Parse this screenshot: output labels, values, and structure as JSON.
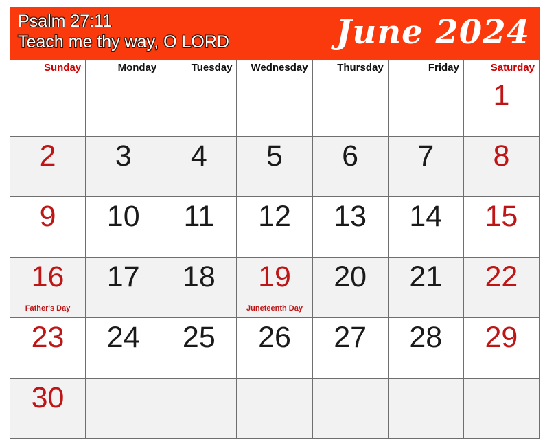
{
  "banner": {
    "verse_reference": "Psalm 27:11",
    "verse_text": "Teach me thy way, O LORD",
    "month_year": "June 2024",
    "background_color": "#FA3A0C",
    "text_color": "#FFFFFF"
  },
  "colors": {
    "accent": "#FA3A0C",
    "holiday_red": "#BE1616",
    "weekend_header_red": "#CC0000",
    "shaded_row": "#F2F2F2",
    "grid_line": "#6F6F6F"
  },
  "weekdays": [
    {
      "label": "Sunday",
      "weekend": true
    },
    {
      "label": "Monday",
      "weekend": false
    },
    {
      "label": "Tuesday",
      "weekend": false
    },
    {
      "label": "Wednesday",
      "weekend": false
    },
    {
      "label": "Thursday",
      "weekend": false
    },
    {
      "label": "Friday",
      "weekend": false
    },
    {
      "label": "Saturday",
      "weekend": true
    }
  ],
  "weeks": [
    {
      "shaded": false,
      "days": [
        {
          "num": ""
        },
        {
          "num": ""
        },
        {
          "num": ""
        },
        {
          "num": ""
        },
        {
          "num": ""
        },
        {
          "num": ""
        },
        {
          "num": "1",
          "red": true
        }
      ]
    },
    {
      "shaded": true,
      "days": [
        {
          "num": "2",
          "red": true
        },
        {
          "num": "3"
        },
        {
          "num": "4"
        },
        {
          "num": "5"
        },
        {
          "num": "6"
        },
        {
          "num": "7"
        },
        {
          "num": "8",
          "red": true
        }
      ]
    },
    {
      "shaded": false,
      "days": [
        {
          "num": "9",
          "red": true
        },
        {
          "num": "10"
        },
        {
          "num": "11"
        },
        {
          "num": "12"
        },
        {
          "num": "13"
        },
        {
          "num": "14"
        },
        {
          "num": "15",
          "red": true
        }
      ]
    },
    {
      "shaded": true,
      "days": [
        {
          "num": "16",
          "red": true,
          "holiday": "Father's Day"
        },
        {
          "num": "17"
        },
        {
          "num": "18"
        },
        {
          "num": "19",
          "red": true,
          "holiday": "Juneteenth Day"
        },
        {
          "num": "20"
        },
        {
          "num": "21"
        },
        {
          "num": "22",
          "red": true
        }
      ]
    },
    {
      "shaded": false,
      "days": [
        {
          "num": "23",
          "red": true
        },
        {
          "num": "24"
        },
        {
          "num": "25"
        },
        {
          "num": "26"
        },
        {
          "num": "27"
        },
        {
          "num": "28"
        },
        {
          "num": "29",
          "red": true
        }
      ]
    },
    {
      "shaded": true,
      "days": [
        {
          "num": "30",
          "red": true
        },
        {
          "num": ""
        },
        {
          "num": ""
        },
        {
          "num": ""
        },
        {
          "num": ""
        },
        {
          "num": ""
        },
        {
          "num": ""
        }
      ]
    }
  ]
}
